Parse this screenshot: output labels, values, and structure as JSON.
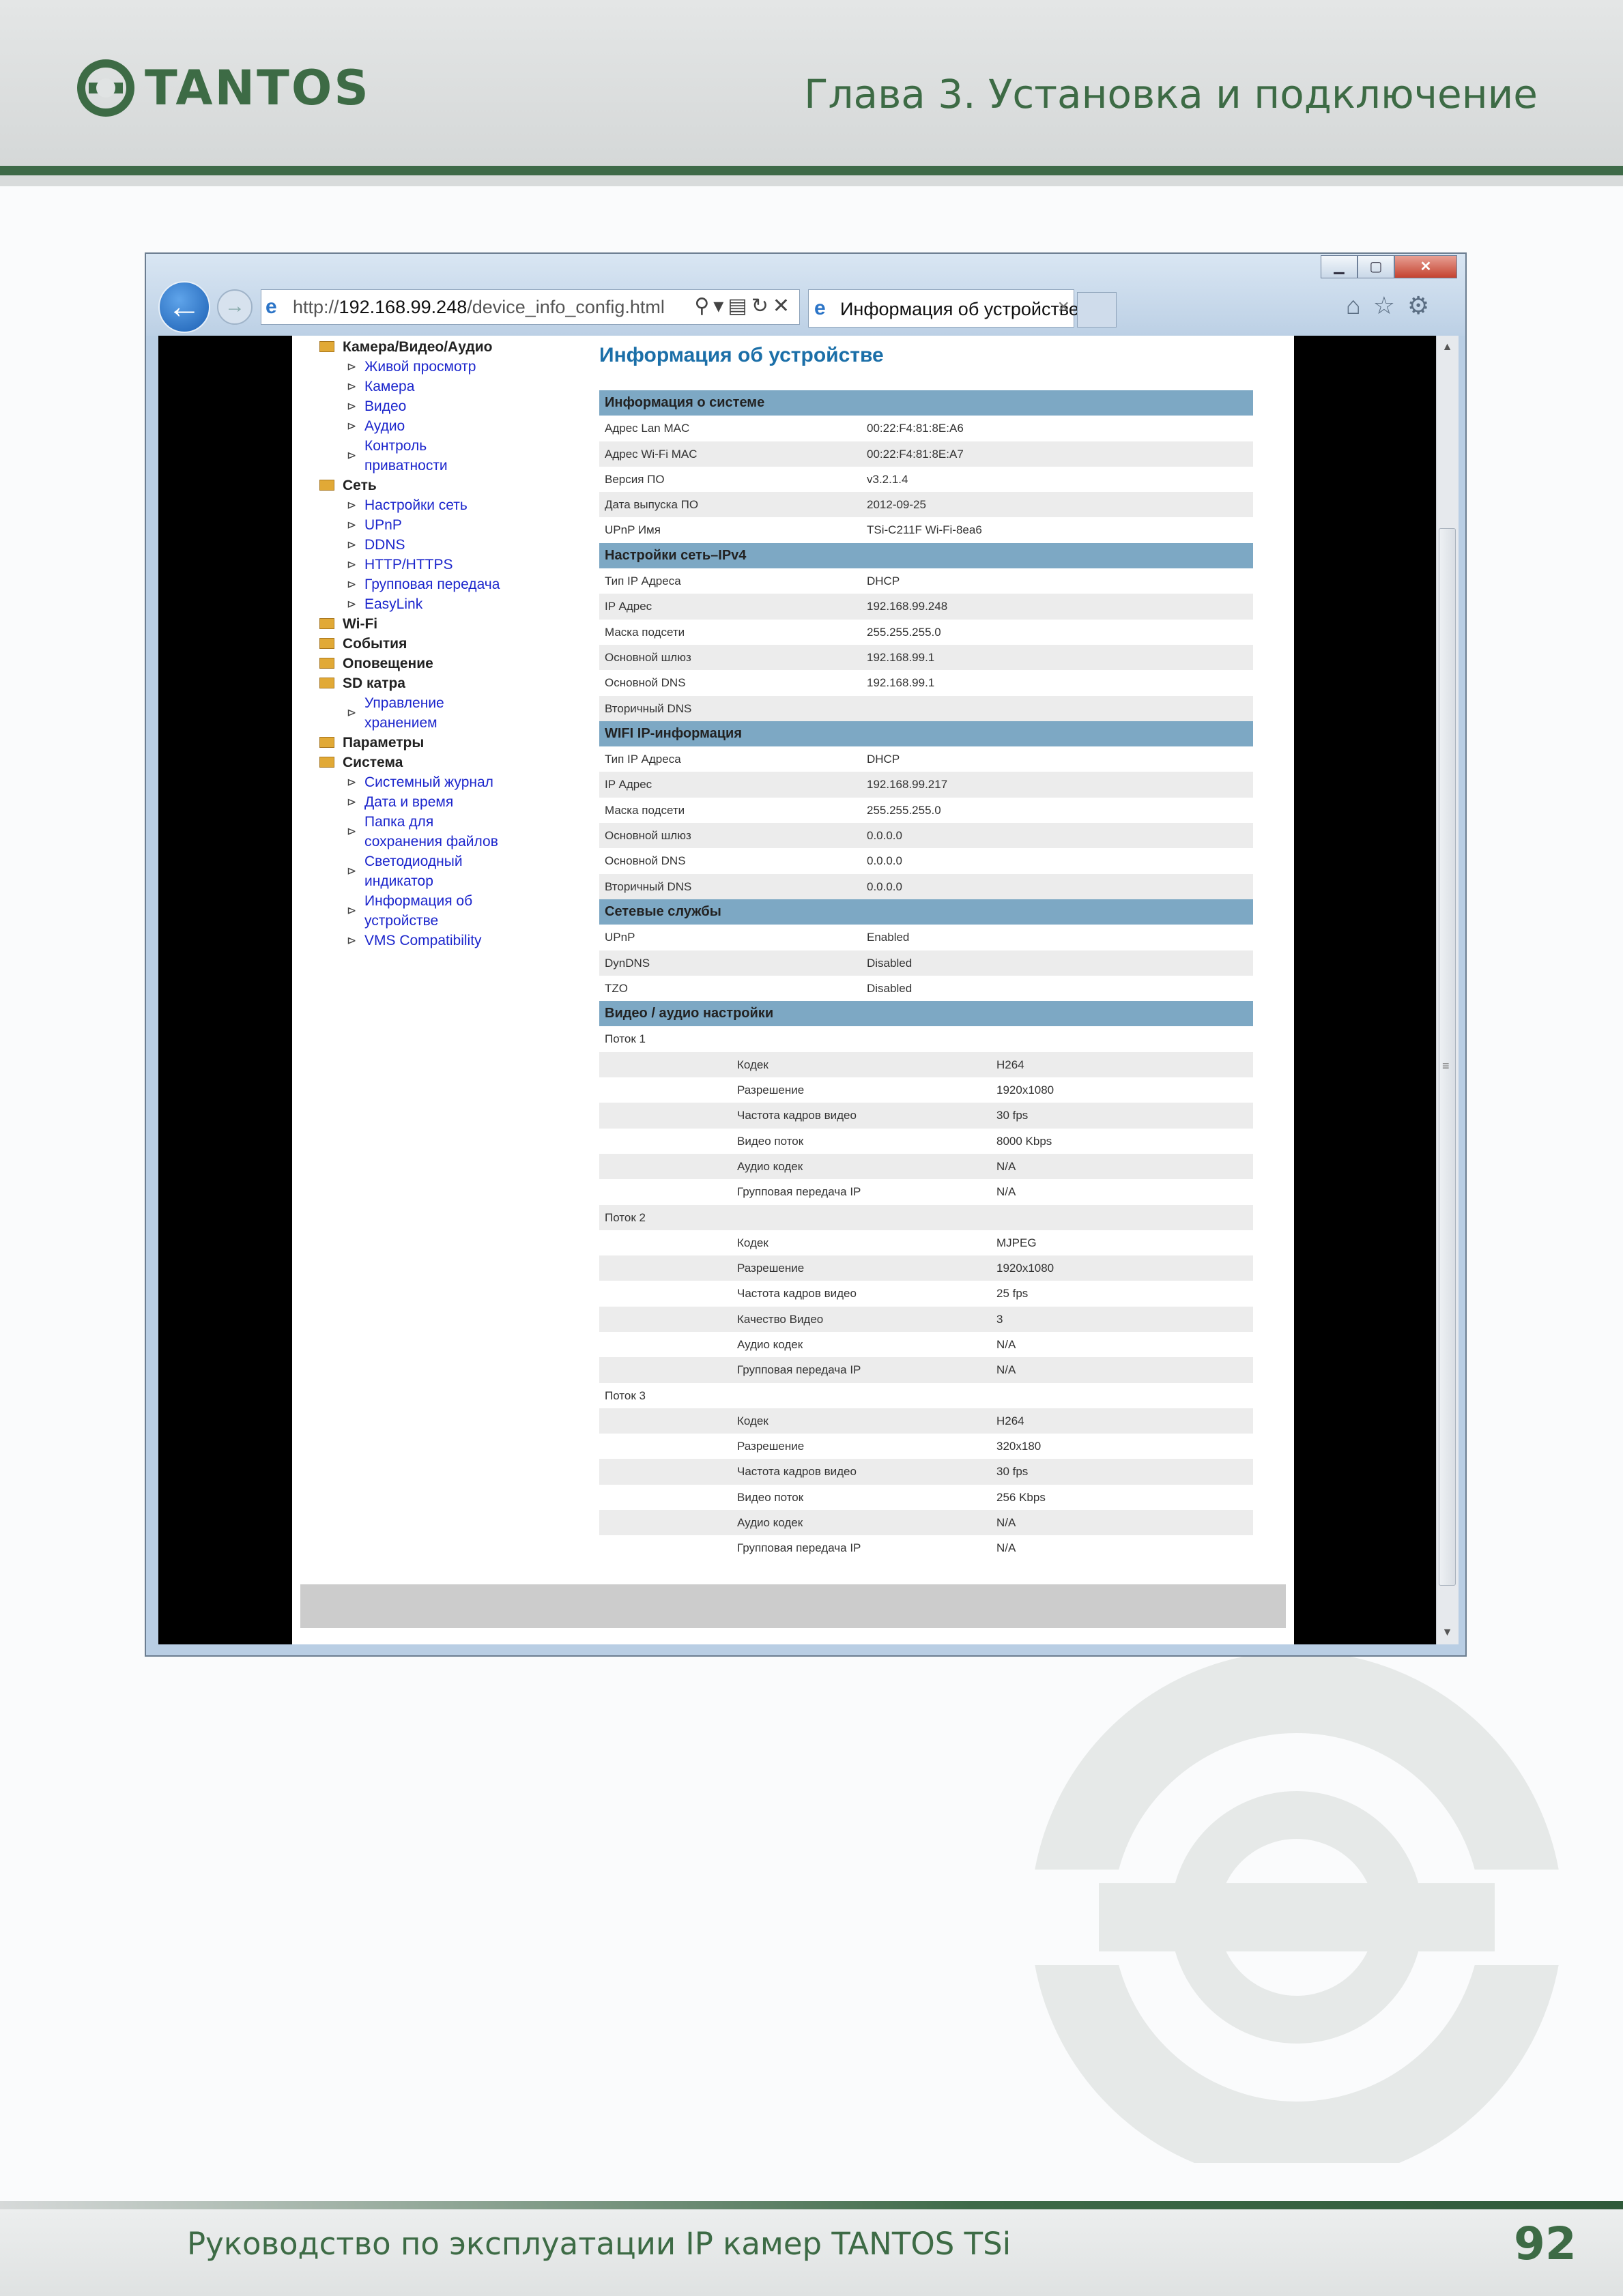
{
  "header": {
    "logo_text": "TANTOS",
    "chapter": "Глава 3. Установка и подключение"
  },
  "footer": {
    "manual_title": "Руководство по эксплуатации IP камер TANTOS TSi",
    "page_number": "92"
  },
  "browser": {
    "url_host": "192.168.99.248",
    "url_prefix": "http://",
    "url_path": "/device_info_config.html",
    "tab_title": "Информация об устройстве",
    "window_buttons": {
      "minimize": "▁",
      "maximize": "▢",
      "close": "✕"
    }
  },
  "nav": {
    "camera_section": "Камера/Видео/Аудио",
    "camera_items": [
      "Живой просмотр",
      "Камера",
      "Видео",
      "Аудио",
      "Контроль",
      "приватности"
    ],
    "network_section": "Сеть",
    "network_items": [
      "Настройки сеть",
      "UPnP",
      "DDNS",
      "HTTP/HTTPS",
      "Групповая передача",
      "EasyLink"
    ],
    "wifi": "Wi-Fi",
    "events": "События",
    "alerts": "Оповещение",
    "sd_section": "SD катра",
    "sd_items": [
      "Управление",
      "хранением"
    ],
    "params": "Параметры",
    "system_section": "Система",
    "system_items": [
      "Системный журнал",
      "Дата и время",
      "Папка для",
      "сохранения файлов",
      "Светодиодный",
      "индикатор",
      "Информация об",
      "устройстве",
      "VMS Compatibility"
    ]
  },
  "page_title": "Информация об устройстве",
  "sections": {
    "system": "Информация о системе",
    "network": "Настройки сеть–IPv4",
    "wifi": "WIFI IP-информация",
    "services": "Сетевые службы",
    "video": "Видео / аудио настройки"
  },
  "system_rows": [
    [
      "Адрес Lan MAC",
      "00:22:F4:81:8E:A6"
    ],
    [
      "Адрес Wi-Fi MAC",
      "00:22:F4:81:8E:A7"
    ],
    [
      "Версия ПО",
      "v3.2.1.4"
    ],
    [
      "Дата выпуска ПО",
      "2012-09-25"
    ],
    [
      "UPnP Имя",
      "TSi-C211F Wi-Fi-8ea6"
    ]
  ],
  "network_rows": [
    [
      "Тип IP Адреса",
      "DHCP"
    ],
    [
      "IP Адрес",
      "192.168.99.248"
    ],
    [
      "Маска подсети",
      "255.255.255.0"
    ],
    [
      "Основной шлюз",
      "192.168.99.1"
    ],
    [
      "Основной DNS",
      "192.168.99.1"
    ],
    [
      "Вторичный DNS",
      ""
    ]
  ],
  "wifi_rows": [
    [
      "Тип IP Адреса",
      "DHCP"
    ],
    [
      "IP Адрес",
      "192.168.99.217"
    ],
    [
      "Маска подсети",
      "255.255.255.0"
    ],
    [
      "Основной шлюз",
      "0.0.0.0"
    ],
    [
      "Основной DNS",
      "0.0.0.0"
    ],
    [
      "Вторичный DNS",
      "0.0.0.0"
    ]
  ],
  "service_rows": [
    [
      "UPnP",
      "Enabled"
    ],
    [
      "DynDNS",
      "Disabled"
    ],
    [
      "TZO",
      "Disabled"
    ]
  ],
  "streams": [
    {
      "label": "Поток 1",
      "rows": [
        [
          "Кодек",
          "H264"
        ],
        [
          "Разрешение",
          "1920x1080"
        ],
        [
          "Частота кадров видео",
          "30 fps"
        ],
        [
          "Видео поток",
          "8000 Kbps"
        ],
        [
          "Аудио кодек",
          "N/A"
        ],
        [
          "Групповая передача IP",
          "N/A"
        ]
      ]
    },
    {
      "label": "Поток 2",
      "rows": [
        [
          "Кодек",
          "MJPEG"
        ],
        [
          "Разрешение",
          "1920x1080"
        ],
        [
          "Частота кадров видео",
          "25 fps"
        ],
        [
          "Качество Видео",
          "3"
        ],
        [
          "Аудио кодек",
          "N/A"
        ],
        [
          "Групповая передача IP",
          "N/A"
        ]
      ]
    },
    {
      "label": "Поток 3",
      "rows": [
        [
          "Кодек",
          "H264"
        ],
        [
          "Разрешение",
          "320x180"
        ],
        [
          "Частота кадров видео",
          "30 fps"
        ],
        [
          "Видео поток",
          "256 Kbps"
        ],
        [
          "Аудио кодек",
          "N/A"
        ],
        [
          "Групповая передача IP",
          "N/A"
        ]
      ]
    }
  ],
  "colors": {
    "brand_green": "#3d6b45",
    "section_header": "#7da8c4",
    "title_blue": "#1b6fa8",
    "link_blue": "#1b25cc"
  }
}
